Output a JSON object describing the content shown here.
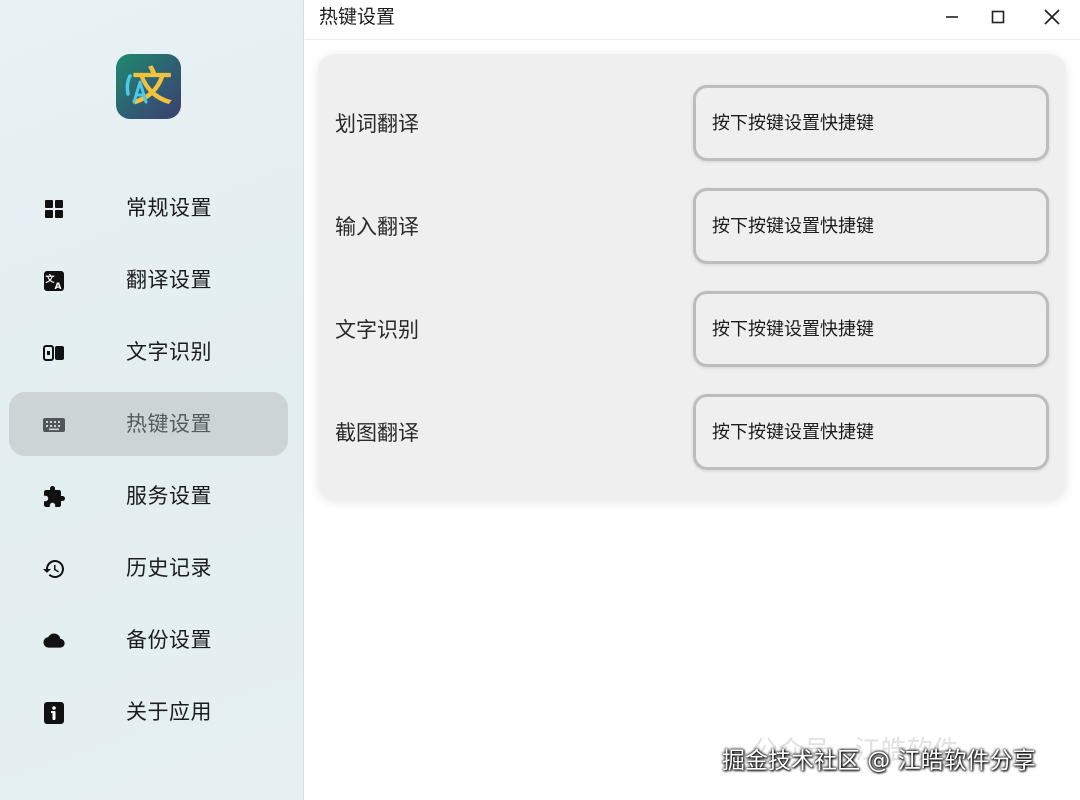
{
  "window": {
    "title": "热键设置",
    "controls": [
      "minimize-icon",
      "maximize-icon",
      "close-icon"
    ]
  },
  "sidebar": {
    "logo": {
      "glyph": "文",
      "icon": "translate-logo"
    },
    "items": [
      {
        "label": "常规设置",
        "icon": "grid-icon",
        "active": false
      },
      {
        "label": "翻译设置",
        "icon": "translate-icon",
        "active": false
      },
      {
        "label": "文字识别",
        "icon": "ocr-icon",
        "active": false
      },
      {
        "label": "热键设置",
        "icon": "keyboard-icon",
        "active": true
      },
      {
        "label": "服务设置",
        "icon": "puzzle-icon",
        "active": false
      },
      {
        "label": "历史记录",
        "icon": "history-icon",
        "active": false
      },
      {
        "label": "备份设置",
        "icon": "cloud-icon",
        "active": false
      },
      {
        "label": "关于应用",
        "icon": "info-icon",
        "active": false
      }
    ]
  },
  "hotkeys": [
    {
      "label": "划词翻译",
      "placeholder": "按下按键设置快捷键"
    },
    {
      "label": "输入翻译",
      "placeholder": "按下按键设置快捷键"
    },
    {
      "label": "文字识别",
      "placeholder": "按下按键设置快捷键"
    },
    {
      "label": "截图翻译",
      "placeholder": "按下按键设置快捷键"
    }
  ],
  "watermark": {
    "main": "掘金技术社区 @ 江皓软件分享",
    "faint": "公众号 · 江皓软件"
  },
  "colors": {
    "sidebar_bg": "#e5eff1",
    "active_item_bg": "#ccd4d6",
    "card_bg": "#efefef",
    "input_border": "#bdbdbd"
  }
}
